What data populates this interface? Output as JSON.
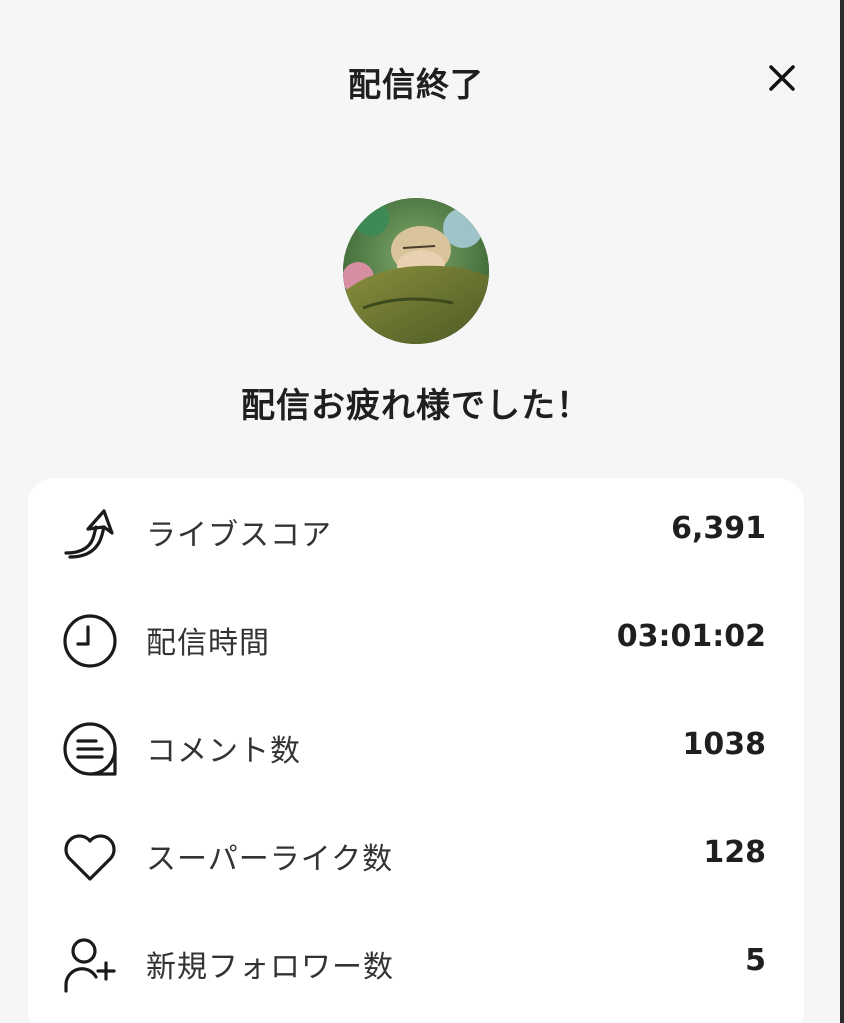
{
  "header": {
    "title": "配信終了",
    "close_icon": "close-icon"
  },
  "profile": {
    "avatar_icon": "streamer-avatar",
    "greeting": "配信お疲れ様でした！"
  },
  "stats": [
    {
      "icon": "arrow-up-swoosh-icon",
      "label": "ライブスコア",
      "value": "6,391"
    },
    {
      "icon": "clock-icon",
      "label": "配信時間",
      "value": "03:01:02"
    },
    {
      "icon": "comment-icon",
      "label": "コメント数",
      "value": "1038"
    },
    {
      "icon": "heart-icon",
      "label": "スーパーライク数",
      "value": "128"
    },
    {
      "icon": "add-user-icon",
      "label": "新規フォロワー数",
      "value": "5"
    }
  ],
  "colors": {
    "background": "#f6f6f6",
    "card": "#ffffff",
    "text": "#1f1f1f"
  }
}
